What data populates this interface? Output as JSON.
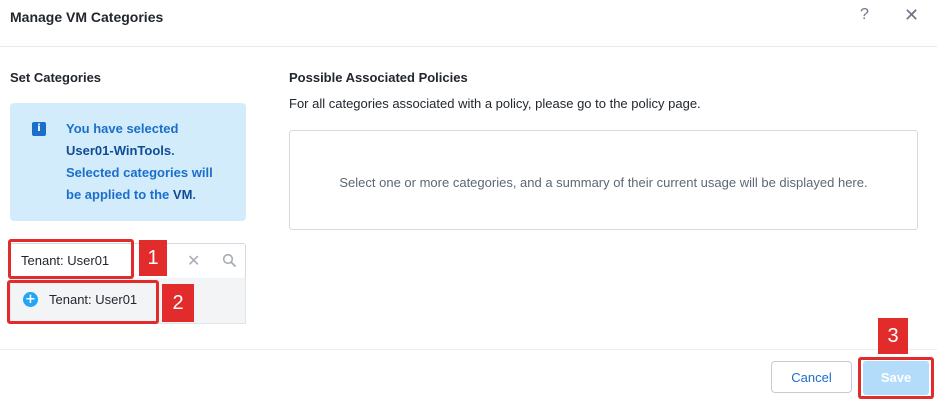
{
  "dialog": {
    "title": "Manage VM Categories",
    "help_glyph": "?",
    "close_glyph": "✕"
  },
  "left": {
    "heading": "Set Categories",
    "info": {
      "line1": "You have selected",
      "vm_name": "User01-WinTools",
      "line3": "Selected categories will",
      "line4": "be applied to the",
      "vm_word": "VM",
      "icon": "info-icon"
    },
    "search": {
      "value": "Tenant: User01",
      "clear_glyph": "✕",
      "search_icon": "magnifier-icon"
    },
    "suggestion": {
      "label": "Tenant: User01",
      "icon": "add-circle-icon"
    }
  },
  "right": {
    "heading": "Possible Associated Policies",
    "description": "For all categories associated with a policy, please go to the policy page.",
    "empty_message": "Select one or more categories, and a summary of their current usage will be displayed here."
  },
  "footer": {
    "cancel_label": "Cancel",
    "save_label": "Save"
  },
  "annotations": {
    "step1": "1",
    "step2": "2",
    "step3": "3",
    "color": "#e22b2b"
  },
  "colors": {
    "accent": "#1b6fcb",
    "info_bg": "#d3ecfb",
    "save_disabled": "#b3dcfa",
    "add_icon": "#22a5f7"
  }
}
